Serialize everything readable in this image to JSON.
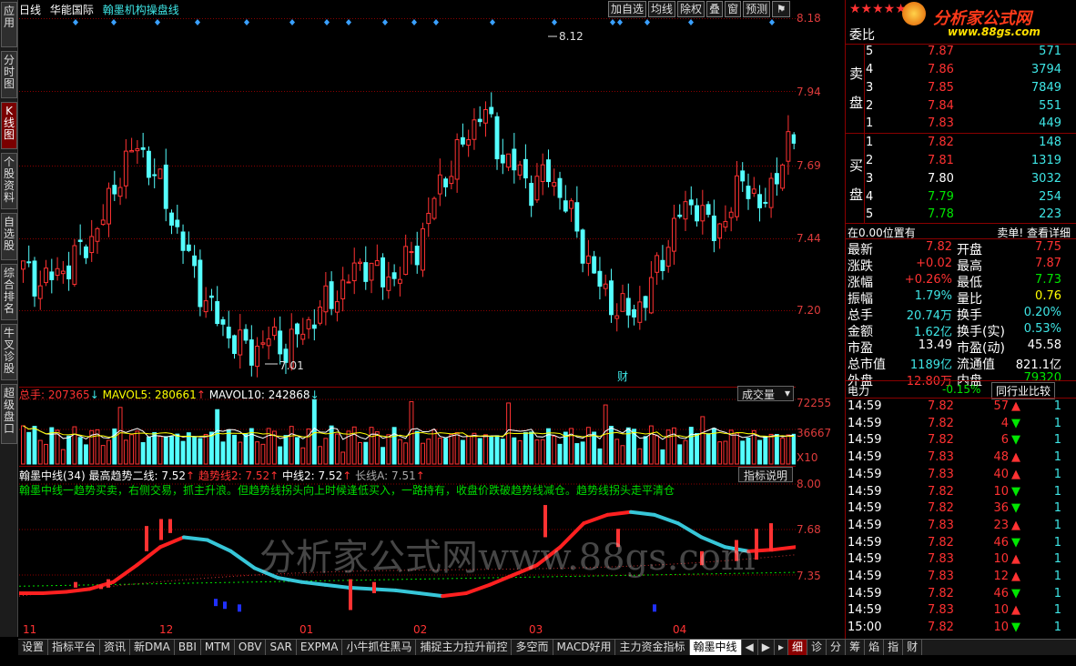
{
  "header": {
    "period": "日线",
    "stock_name": "华能国际",
    "indicator_name": "翰墨机构操盘线"
  },
  "top_buttons": [
    "加自选",
    "均线",
    "除权",
    "叠",
    "窗",
    "预测"
  ],
  "left_tabs": [
    "应用",
    "分时图",
    "K线图",
    "个股资料",
    "自选股",
    "综合排名",
    "牛叉诊股",
    "超级盘口"
  ],
  "price_axis": [
    "8.18",
    "7.94",
    "7.69",
    "7.44",
    "7.20"
  ],
  "annot": {
    "high": "8.12",
    "low": "7.01",
    "cai": "财"
  },
  "volume": {
    "head_label": "总手:",
    "head_value": "207365",
    "head_arrow": "↓",
    "mavol5": "MAVOL5: 280661",
    "mavol5_arrow": "↑",
    "mavol10": "MAVOL10: 242868",
    "mavol10_arrow": "↓",
    "selector": "成交量",
    "axis": [
      "72255",
      "36667",
      "X10"
    ]
  },
  "indicator": {
    "line1_name": "翰墨中线(34)",
    "line1_a": "最高趋势二线: 7.52",
    "line1_b": "趋势线2: 7.52",
    "line1_c": "中线2: 7.52",
    "line1_d": "长线A: 7.51",
    "desc": "翰墨中线一趋势买卖，右侧交易，抓主升浪。但趋势线拐头向上时候逢低买入，一路持有，收盘价跌破趋势线减仓。趋势线拐头走平清仓",
    "button": "指标说明",
    "axis": [
      "8.00",
      "7.68",
      "7.35"
    ]
  },
  "watermark": "分析家公式网www.88gs.com",
  "x_labels": [
    "11",
    "12",
    "01",
    "02",
    "03",
    "04"
  ],
  "bottom_tabs": [
    "设置",
    "指标平台",
    "资讯",
    "新DMA",
    "BBI",
    "MTM",
    "OBV",
    "SAR",
    "EXPMA",
    "小牛抓住黑马",
    "捕捉主力拉升前控",
    "多空而",
    "MACD好用",
    "主力资金指标",
    "翰墨中线"
  ],
  "bottom_right_tabs": [
    "细",
    "诊",
    "分",
    "筹",
    "焰",
    "指",
    "财"
  ],
  "logo": {
    "stars": "★★★★★",
    "text": "分析家公式网",
    "url": "www.88gs.com"
  },
  "order_book": {
    "title": "委比",
    "sell_label": [
      "卖",
      "盘"
    ],
    "buy_label": [
      "买",
      "盘"
    ],
    "sell": [
      {
        "lv": "5",
        "p": "7.87",
        "v": "571"
      },
      {
        "lv": "4",
        "p": "7.86",
        "v": "3794"
      },
      {
        "lv": "3",
        "p": "7.85",
        "v": "7849"
      },
      {
        "lv": "2",
        "p": "7.84",
        "v": "551"
      },
      {
        "lv": "1",
        "p": "7.83",
        "v": "449"
      }
    ],
    "buy": [
      {
        "lv": "1",
        "p": "7.82",
        "v": "148"
      },
      {
        "lv": "2",
        "p": "7.81",
        "v": "1319"
      },
      {
        "lv": "3",
        "p": "7.80",
        "v": "3032"
      },
      {
        "lv": "4",
        "p": "7.79",
        "v": "254"
      },
      {
        "lv": "5",
        "p": "7.78",
        "v": "223"
      }
    ],
    "pos_text": "在0.00位置有",
    "pos_link": "卖单! 查看详细"
  },
  "quote": {
    "rows": [
      {
        "l1": "最新",
        "v1": "7.82",
        "l2": "开盘",
        "v2": "7.75"
      },
      {
        "l1": "涨跌",
        "v1": "+0.02",
        "l2": "最高",
        "v2": "7.87"
      },
      {
        "l1": "涨幅",
        "v1": "+0.26%",
        "l2": "最低",
        "v2": "7.73"
      },
      {
        "l1": "振幅",
        "v1": "1.79%",
        "l2": "量比",
        "v2": "0.76"
      },
      {
        "l1": "总手",
        "v1": "20.74万",
        "l2": "换手",
        "v2": "0.20%"
      },
      {
        "l1": "金额",
        "v1": "1.62亿",
        "l2": "换手(实)",
        "v2": "0.53%"
      },
      {
        "l1": "市盈",
        "v1": "13.49",
        "l2": "市盈(动)",
        "v2": "45.58"
      },
      {
        "l1": "总市值",
        "v1": "1189亿",
        "l2": "流通值",
        "v2": "821.1亿"
      },
      {
        "l1": "外盘",
        "v1": "12.80万",
        "l2": "内盘",
        "v2": "79320"
      }
    ]
  },
  "sector": {
    "name": "电力",
    "change": "-0.15%",
    "button": "同行业比较"
  },
  "ticks": [
    {
      "t": "14:59",
      "p": "7.82",
      "v": "57",
      "d": "up",
      "n": "1"
    },
    {
      "t": "14:59",
      "p": "7.82",
      "v": "4",
      "d": "down",
      "n": "1"
    },
    {
      "t": "14:59",
      "p": "7.82",
      "v": "6",
      "d": "down",
      "n": "1"
    },
    {
      "t": "14:59",
      "p": "7.83",
      "v": "48",
      "d": "up",
      "n": "1"
    },
    {
      "t": "14:59",
      "p": "7.83",
      "v": "40",
      "d": "up",
      "n": "1"
    },
    {
      "t": "14:59",
      "p": "7.82",
      "v": "10",
      "d": "down",
      "n": "1"
    },
    {
      "t": "14:59",
      "p": "7.82",
      "v": "36",
      "d": "down",
      "n": "1"
    },
    {
      "t": "14:59",
      "p": "7.83",
      "v": "23",
      "d": "up",
      "n": "1"
    },
    {
      "t": "14:59",
      "p": "7.82",
      "v": "46",
      "d": "down",
      "n": "1"
    },
    {
      "t": "14:59",
      "p": "7.83",
      "v": "10",
      "d": "up",
      "n": "1"
    },
    {
      "t": "14:59",
      "p": "7.83",
      "v": "12",
      "d": "up",
      "n": "1"
    },
    {
      "t": "14:59",
      "p": "7.82",
      "v": "46",
      "d": "down",
      "n": "1"
    },
    {
      "t": "14:59",
      "p": "7.83",
      "v": "10",
      "d": "up",
      "n": "1"
    },
    {
      "t": "15:00",
      "p": "7.82",
      "v": "10",
      "d": "down",
      "n": "1"
    }
  ],
  "colors": {
    "up": "#ff3232",
    "down": "#54ffff",
    "axis": "#8a0000"
  }
}
